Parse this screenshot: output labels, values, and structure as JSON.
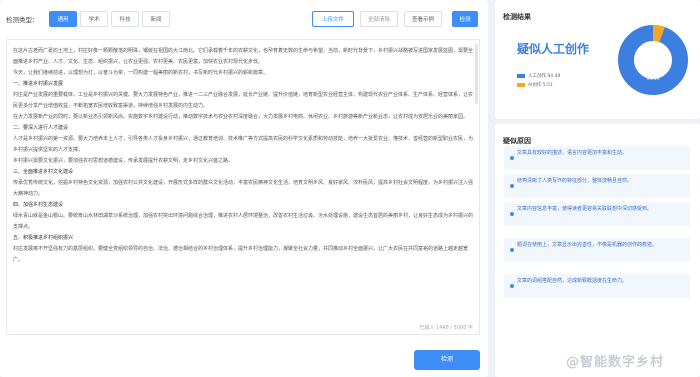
{
  "toolbar": {
    "label": "检测类型：",
    "tabs": [
      "通用",
      "学术",
      "科技",
      "新闻"
    ],
    "upload_label": "上传文件",
    "clear_label": "全部清除",
    "sample_label": "查看示例",
    "detect_label": "检测"
  },
  "editor": {
    "paragraphs": [
      "在这片古老而广袤的土地上，村庄好像一颗颗散落的明珠，镶嵌在祖国的大江南北。它们承载着千年的农耕文化，也孕育着无数的生命与希望。当前，新时代背景下，乡村振兴战略被写进国家发展蓝图，需要全面推进乡村产业、人才、文化、生态、组织振兴，让农业更强、农村更美、农民更富，加快农业农村现代化步伐。",
      "今天，让我们继续前进，以理想为灯，以奋斗为桨，一同构建一幅美丽的新农村，书写新时代乡村振兴的崭新篇章。",
      "一、推进乡村振兴发展",
      "村庄是产业发展的重要载体，工业是乡村振兴的关键。要大力发展特色产业，推进一二三产业融合发展，延长产业链、提升价值链，培育新型农业经营主体，构建现代农业产业体系、生产体系、经营体系，让农民更多分享产业增值收益，不断拓宽农民增收致富渠道，持续增强乡村发展的内生动力。",
      "在大力发展新产业的同时，要以新业态引领新风尚。实施数字乡村建设行动，推动数字技术与农业农村深度融合，大力发展乡村电商、休闲农业、乡村旅游等新产业新业态，让农村成为安居乐业的美丽家园。",
      "二、要深入进行人才建设",
      "人才是乡村振兴的第一资源。要大力培养本土人才，引导各类人才投身乡村振兴，通过教育培训、技术推广等方式提高农民的科学文化素质和劳动技能，培养一大批爱农业、懂技术、善经营的新型职业农民，为乡村振兴提供坚实的人才支撑。",
      "乡村振兴需要文化振兴，要加强农村思想道德建设，传承发展提升农耕文明，走乡村文化兴盛之路。",
      "三、全面推进乡村文化建设",
      "传承优秀传统文化，挖掘乡村特色文化资源，加强农村公共文化建设，开展形式多样的群众文化活动，丰富农民精神文化生活，培育文明乡风、良好家风、淳朴民风，提高乡村社会文明程度，为乡村振兴注入强大精神动力。",
      "四、加强乡村生态建设",
      "绿水青山就是金山银山。要统筹山水林田湖草沙系统治理，加强农村突出环境问题综合治理，推进农村人居环境整治，改善农村生活垃圾、污水处理设施，建设生态宜居的美丽乡村，让良好生态成为乡村振兴的支撑点。",
      "五、积极推进乡村组织振兴",
      "村庄发展离不开坚强有力的基层组织。要健全党组织领导的自治、法治、德治相结合的乡村治理体系，提升乡村治理能力，凝聚全社会力量，共同推动乡村全面振兴，让广大农民在共同富裕的道路上越走越宽广。"
    ],
    "counter": "已输入 1448 / 5000 字"
  },
  "result": {
    "title": "检测结果",
    "verdict": "疑似人工创作",
    "legend": [
      {
        "label": "人工创作 94.49",
        "color": "#3d7fe0"
      },
      {
        "label": "AI创作 5.51",
        "color": "#f5a623"
      }
    ],
    "ai_fraction": 0.0551,
    "center_value": "94.49"
  },
  "reasons": {
    "title": "疑似原因",
    "items": [
      "文章具有较好的描述，语言内容更加丰富和生动。",
      "结构清晰了人类写作的特征部分，整体流畅且自然。",
      "文章内容信息丰富，使得读者更容易关联联想中深切感受到。",
      "题词在使用上，文章显示出完善性，不像是机器的创作的痕迹。",
      "文章的词组搭配自然，达成新颖概括度在生命力。"
    ]
  },
  "watermark": "@智能数字乡村"
}
